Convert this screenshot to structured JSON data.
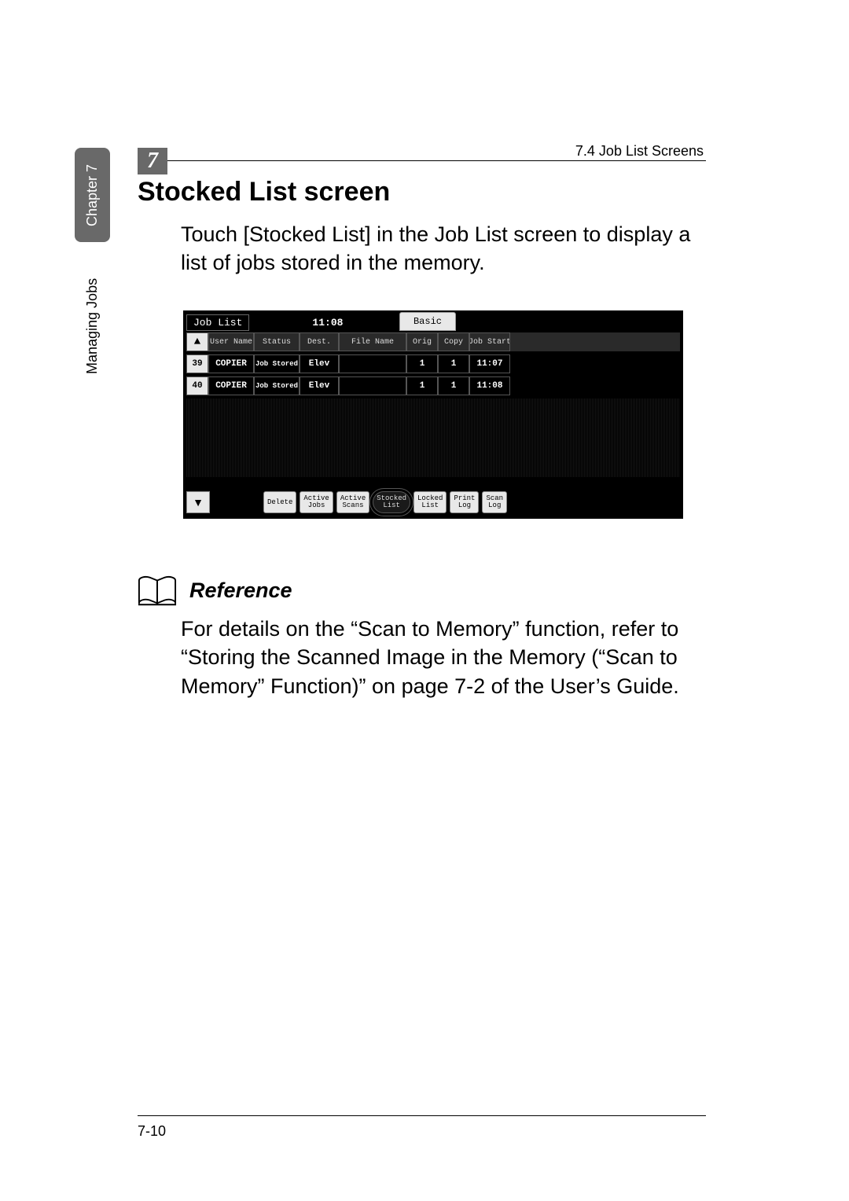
{
  "header": {
    "chapter_number": "7",
    "right_text": "7.4 Job List Screens"
  },
  "sidebar": {
    "tab_label": "Chapter 7",
    "vertical_label": "Managing Jobs"
  },
  "title": "Stocked List screen",
  "paragraph1": "Touch [Stocked List] in the Job List screen to display a list of jobs stored in the memory.",
  "device": {
    "title": "Job List",
    "time": "11:08",
    "basic_btn": "Basic",
    "arrow_up": "▲",
    "arrow_down": "▼",
    "columns": {
      "user": "User\nName",
      "status": "Status",
      "dest": "Dest.",
      "file": "File Name",
      "orig": "Orig",
      "copy": "Copy",
      "jobstart": "Job\nStart"
    },
    "rows": [
      {
        "num": "39",
        "user": "COPIER",
        "status": "Job\nStored",
        "dest": "Elev",
        "file": "",
        "orig": "1",
        "copy": "1",
        "jobstart": "11:07"
      },
      {
        "num": "40",
        "user": "COPIER",
        "status": "Job\nStored",
        "dest": "Elev",
        "file": "",
        "orig": "1",
        "copy": "1",
        "jobstart": "11:08"
      }
    ],
    "buttons": {
      "delete": "Delete",
      "active_jobs_1": "Active",
      "active_jobs_2": "Jobs",
      "active_scans_1": "Active",
      "active_scans_2": "Scans",
      "stocked_1": "Stocked",
      "stocked_2": "List",
      "locked_1": "Locked",
      "locked_2": "List",
      "print_log_1": "Print",
      "print_log_2": "Log",
      "scan_log_1": "Scan",
      "scan_log_2": "Log"
    }
  },
  "reference": {
    "label": "Reference",
    "text": "For details on the “Scan to Memory” function, refer to “Storing the Scanned Image in the Memory (“Scan to Memory” Function)” on page 7-2 of the User’s Guide."
  },
  "footer": {
    "page": "7-10"
  }
}
